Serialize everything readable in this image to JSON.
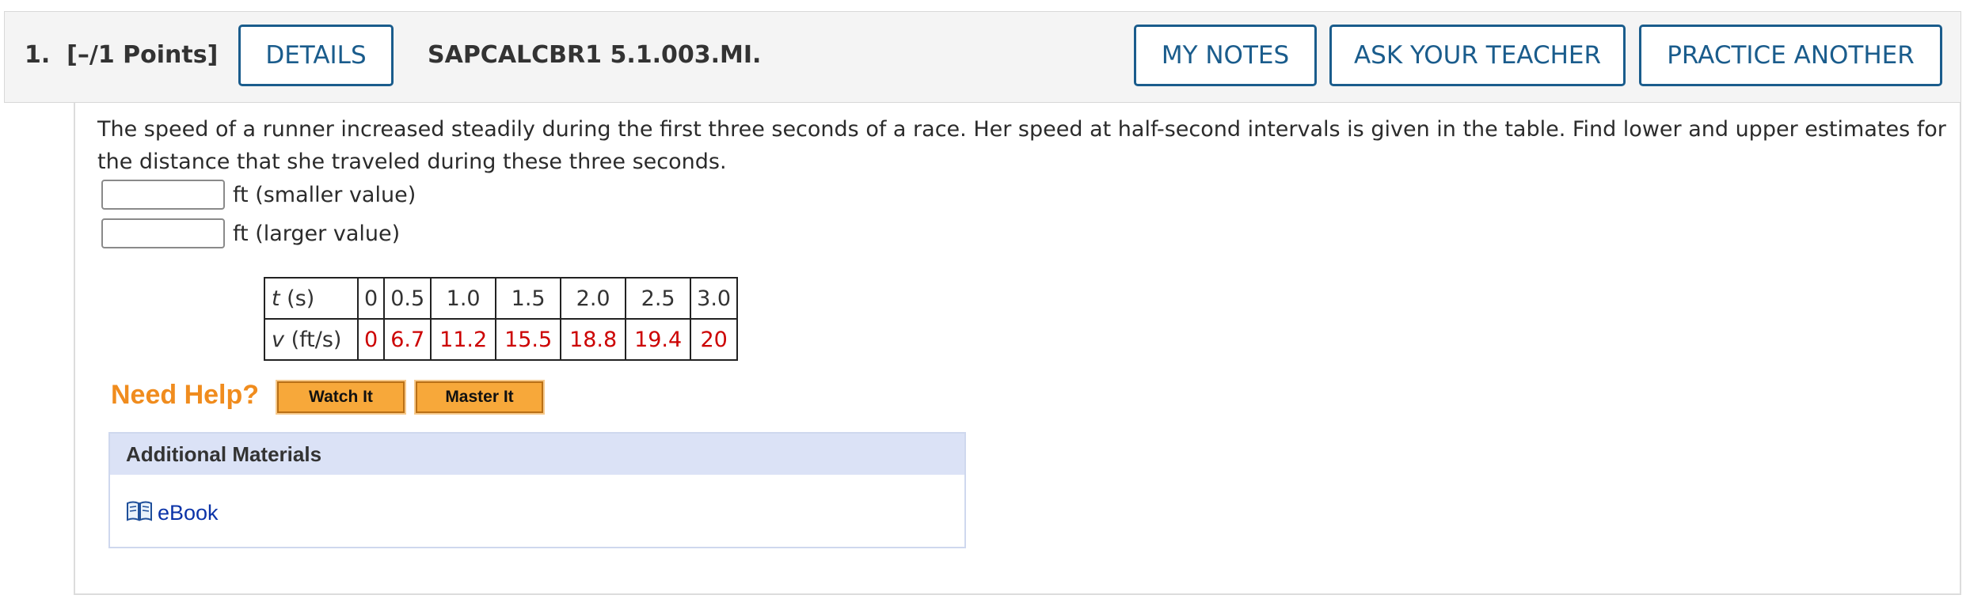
{
  "header": {
    "question_number": "1.",
    "points": "[–/1 Points]",
    "details_label": "DETAILS",
    "problem_code": "SAPCALCBR1 5.1.003.MI.",
    "my_notes_label": "MY NOTES",
    "ask_teacher_label": "ASK YOUR TEACHER",
    "practice_another_label": "PRACTICE ANOTHER"
  },
  "prompt": "The speed of a runner increased steadily during the first three seconds of a race. Her speed at half-second intervals is given in the table. Find lower and upper estimates for the distance that she traveled during these three seconds.",
  "answers": [
    {
      "value": "",
      "label": "ft (smaller value)"
    },
    {
      "value": "",
      "label": "ft (larger value)"
    }
  ],
  "table": {
    "row1_label_var": "t",
    "row1_label_unit": " (s)",
    "row2_label_var": "v",
    "row2_label_unit": " (ft/s)",
    "t_values": [
      "0",
      "0.5",
      "1.0",
      "1.5",
      "2.0",
      "2.5",
      "3.0"
    ],
    "v_values": [
      "0",
      "6.7",
      "11.2",
      "15.5",
      "18.8",
      "19.4",
      "20"
    ]
  },
  "help": {
    "need_help": "Need Help?",
    "watch_it": "Watch It",
    "master_it": "Master It"
  },
  "additional_materials": {
    "title": "Additional Materials",
    "ebook_label": "eBook",
    "ebook_icon": "open-book-icon"
  },
  "colors": {
    "button_blue": "#1a5c8c",
    "table_value_red": "#cc0000",
    "need_help_orange": "#f08c1e",
    "help_button_orange": "#f7a83a",
    "materials_header": "#dbe2f6",
    "link_blue": "#0b33a8"
  }
}
